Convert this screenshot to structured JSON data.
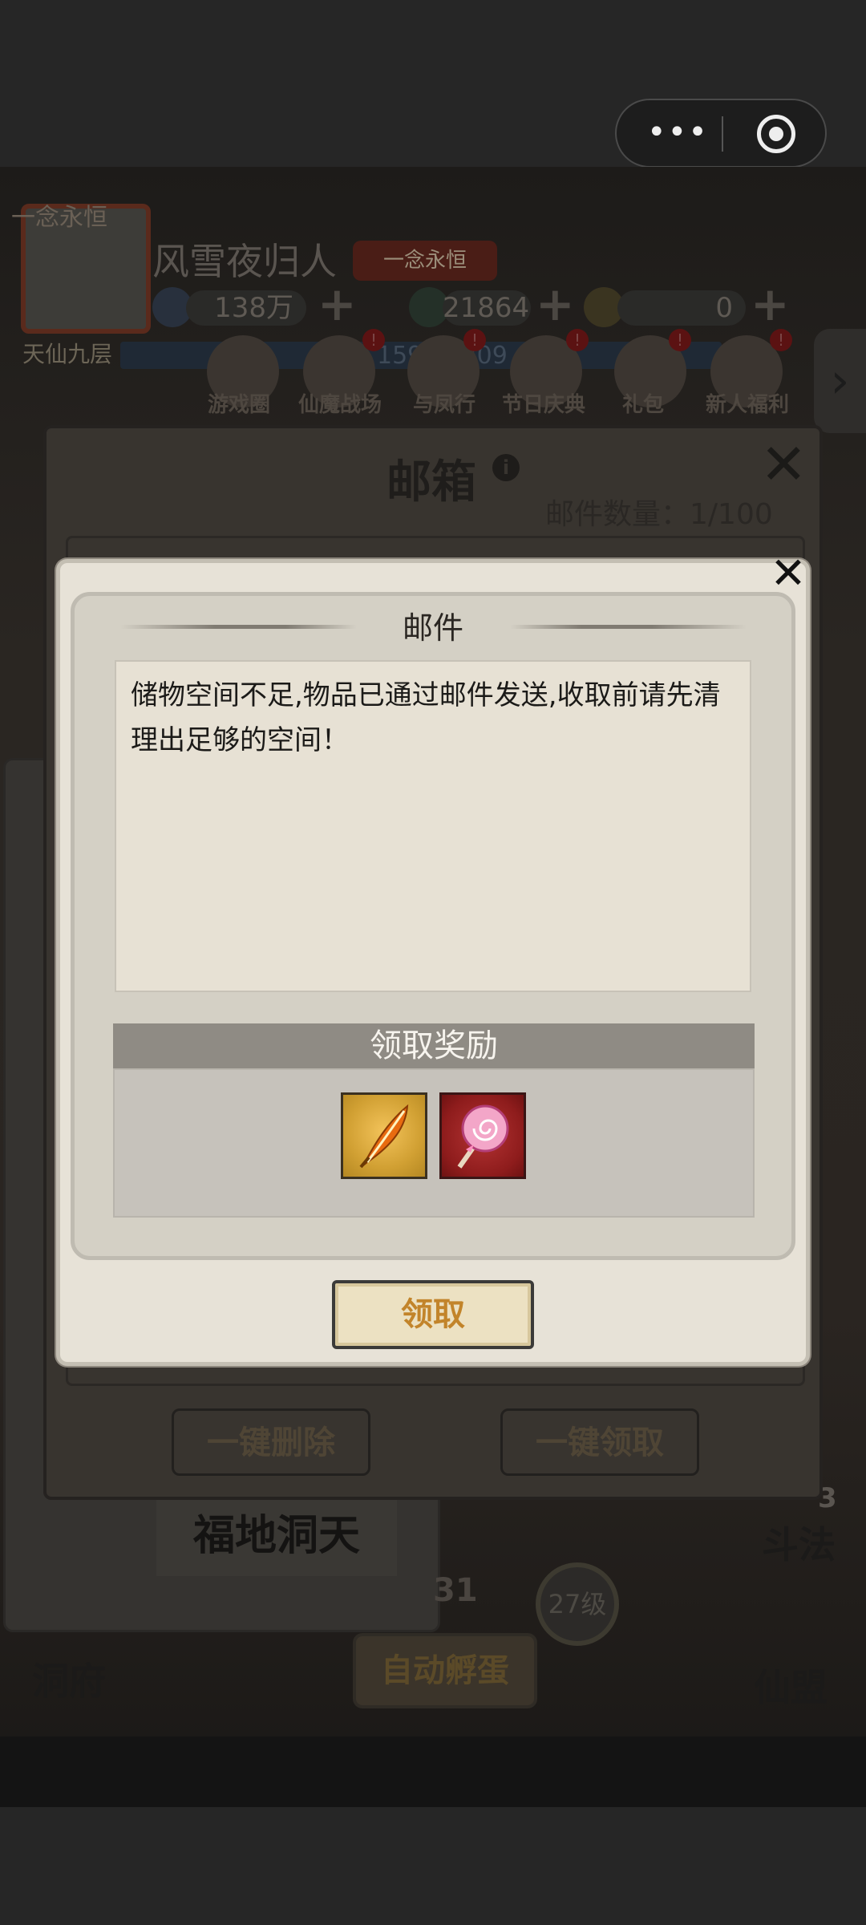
{
  "system": {
    "capsule_menu_label": "•••"
  },
  "game": {
    "logo": "一念永恒",
    "player_name": "风雪夜归人",
    "player_tag": "一念永恒",
    "rank": "天仙九层",
    "xp_text": "159/10309",
    "resources": [
      {
        "icon": "spirit-stone-icon",
        "value": "138万"
      },
      {
        "icon": "jade-icon",
        "value": "21864"
      },
      {
        "icon": "gourd-icon",
        "value": "0"
      }
    ],
    "top_menu": [
      {
        "label": "游戏圈",
        "icon": "game-circle-icon",
        "badge": false
      },
      {
        "label": "仙魔战场",
        "icon": "vortex-icon",
        "badge": true
      },
      {
        "label": "与凤行",
        "icon": "character-icon",
        "badge": true
      },
      {
        "label": "节日庆典",
        "icon": "rabbit-icon",
        "badge": true
      },
      {
        "label": "礼包",
        "icon": "gift-bag-icon",
        "badge": true
      },
      {
        "label": "新人福利",
        "icon": "gift-box-icon",
        "badge": true
      }
    ],
    "fudi_label": "福地洞天",
    "level_badge": "27级",
    "auto_hatch": "自动孵蛋",
    "left_bottom_label": "洞府",
    "right_labels": [
      "斗法",
      "仙盟"
    ],
    "right_count": "3",
    "stat_partial": "31"
  },
  "mailbox": {
    "title": "邮箱",
    "count_label": "邮件数量：1/100",
    "delete_all": "一键删除",
    "claim_all": "一键领取"
  },
  "popup": {
    "title": "邮件",
    "message": "储物空间不足,物品已通过邮件发送,收取前请先清理出足够的空间！",
    "reward_header": "领取奖励",
    "rewards": [
      {
        "icon": "golden-feather-icon"
      },
      {
        "icon": "lollipop-icon"
      }
    ],
    "claim_label": "领取"
  },
  "colors": {
    "popup_bg": "#e7e2d7",
    "reward_header_bg": "#8f8b84",
    "claim_text": "#c2842a"
  }
}
